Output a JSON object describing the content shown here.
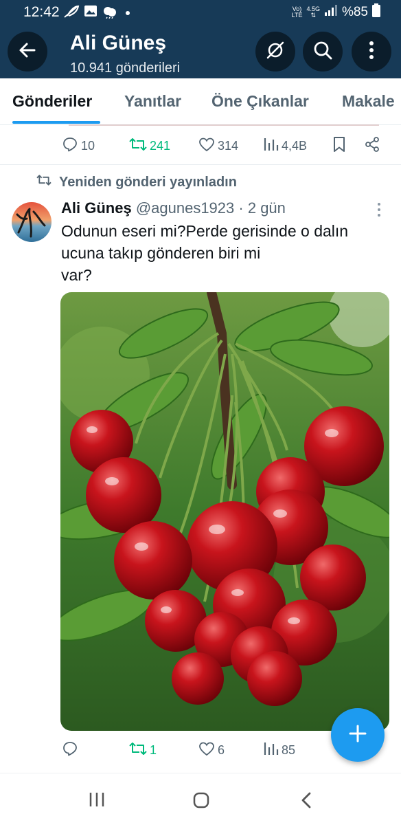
{
  "status_bar": {
    "time": "12:42",
    "net_top": "Vo)",
    "net_bottom": "LTE",
    "net_speed_top": "4.5G",
    "battery": "%85"
  },
  "header": {
    "title": "Ali Güneş",
    "subtitle": "10.941 gönderileri"
  },
  "tabs": [
    {
      "label": "Gönderiler",
      "active": true
    },
    {
      "label": "Yanıtlar",
      "active": false
    },
    {
      "label": "Öne Çıkanlar",
      "active": false
    },
    {
      "label": "Makale",
      "active": false
    }
  ],
  "prev_post_actions": {
    "replies": "10",
    "reposts": "241",
    "likes": "314",
    "views": "4,4B"
  },
  "repost_label": "Yeniden gönderi yayınladın",
  "post": {
    "author_name": "Ali Güneş",
    "handle": "@agunes1923",
    "separator": "·",
    "time": "2 gün",
    "text_lines": [
      "Odunun eseri mi?Perde gerisinde o dalın",
      "ucuna takıp gönderen biri mi",
      "var?"
    ],
    "actions": {
      "replies": "",
      "reposts": "1",
      "likes": "6",
      "views": "85"
    }
  },
  "colors": {
    "header_bg": "#173a57",
    "accent": "#1d9bf0",
    "repost_green": "#00ba7c",
    "secondary_text": "#536471"
  }
}
